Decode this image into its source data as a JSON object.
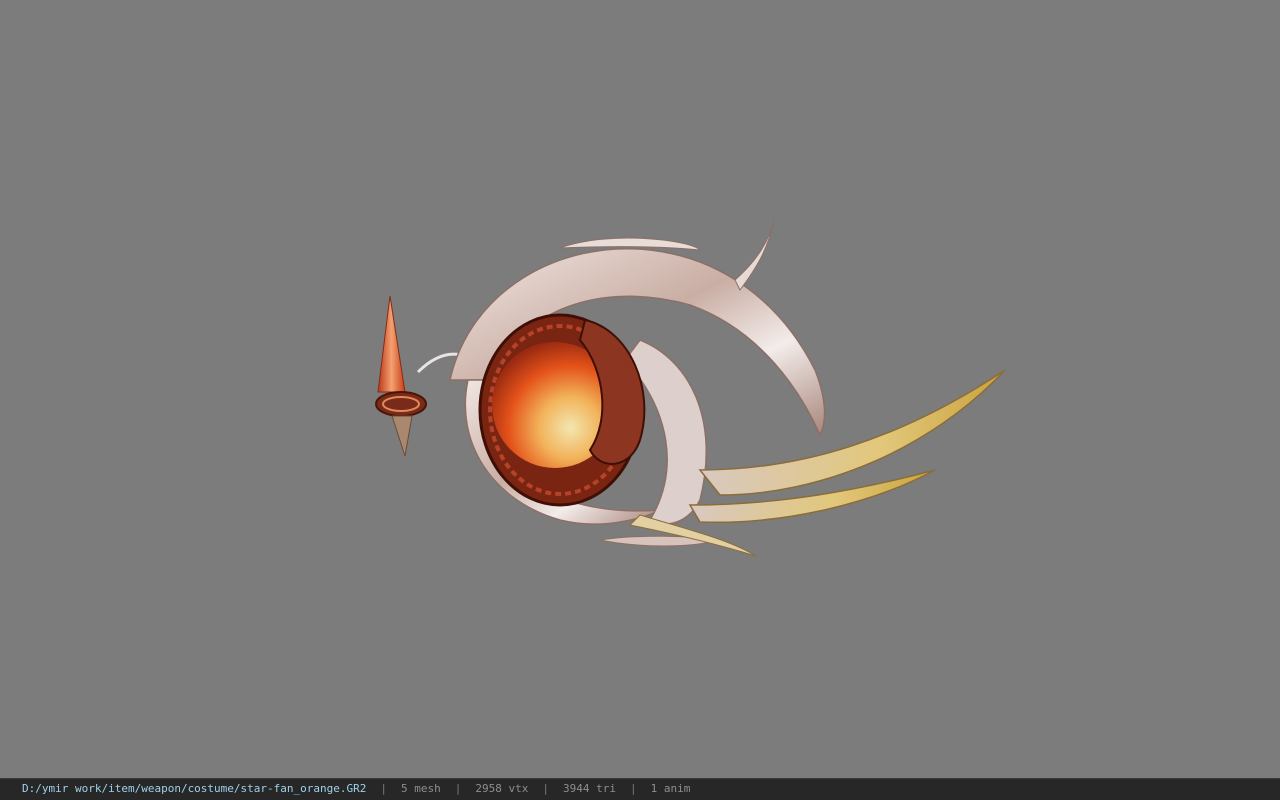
{
  "viewer": {
    "background_color": "#7c7c7c",
    "model_icon": "ornate-fan-weapon-model",
    "accent_colors": {
      "orb_orange": "#e8561c",
      "metal_silver": "#d9c7c0",
      "blade_gold": "#cfa84e"
    }
  },
  "statusbar": {
    "file_path": "D:/ymir work/item/weapon/costume/star-fan_orange.GR2",
    "mesh": "5 mesh",
    "vtx": "2958 vtx",
    "tri": "3944 tri",
    "anim": "1 anim",
    "separator": "|"
  }
}
